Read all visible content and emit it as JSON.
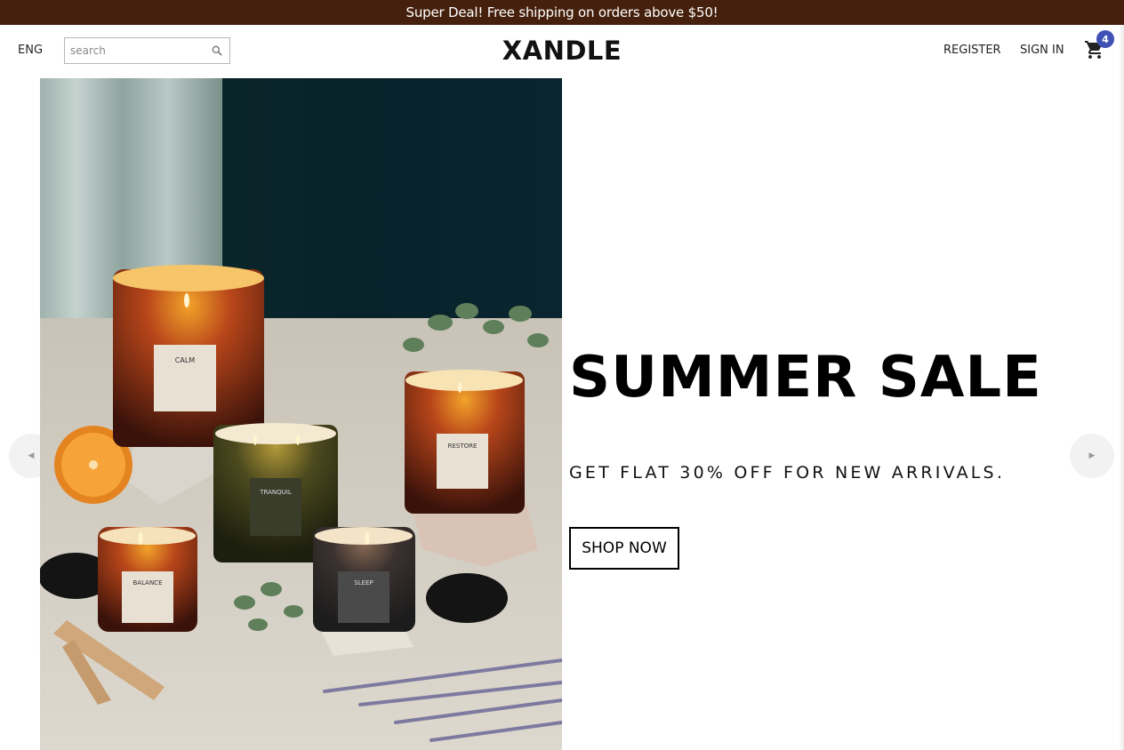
{
  "promo": {
    "text": "Super Deal! Free shipping on orders above $50!"
  },
  "header": {
    "language": "ENG",
    "search_placeholder": "search",
    "search_icon": "search-icon",
    "logo": "XANDLE",
    "register_label": "REGISTER",
    "signin_label": "SIGN IN",
    "cart_icon": "shopping-cart-icon",
    "cart_count": "4"
  },
  "hero": {
    "title": "SUMMER SALE",
    "subtitle": "GET FLAT 30% OFF FOR NEW ARRIVALS.",
    "button_label": "SHOP NOW",
    "image_alt": "Candle product photo",
    "candle_labels": [
      "CALM",
      "TRANQUIL",
      "RESTORE",
      "BALANCE",
      "SLEEP"
    ],
    "prev_arrow": "chevron-left-icon",
    "next_arrow": "chevron-right-icon"
  },
  "colors": {
    "promo_bg": "#45200c",
    "badge_bg": "#3f51b5",
    "text": "#111111"
  }
}
